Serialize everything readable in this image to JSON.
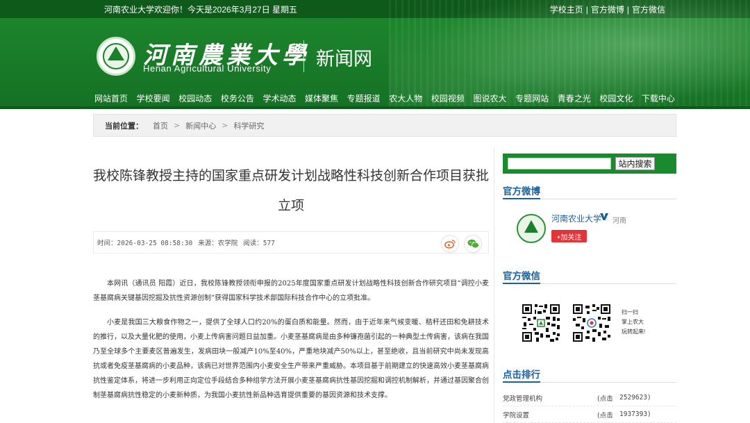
{
  "header": {
    "welcome": "河南农业大学欢迎你！今天是2026年3月27日 星期五",
    "top_links": [
      "学校主页",
      "官方微博",
      "官方微信"
    ],
    "logo_cn": "河南農業大學",
    "logo_en": "Henan Agricultural University",
    "site_title": "新闻网"
  },
  "nav": {
    "items": [
      "网站首页",
      "学校要闻",
      "校园动态",
      "校务公告",
      "学术动态",
      "媒体聚焦",
      "专题报道",
      "农大人物",
      "校园视频",
      "图说农大",
      "专题网站",
      "青春之光",
      "校园文化",
      "下载中心"
    ]
  },
  "breadcrumb": {
    "label": "当前位置：",
    "items": [
      "首页",
      "新闻中心",
      "科学研究"
    ]
  },
  "article": {
    "title": "我校陈锋教授主持的国家重点研发计划战略性科技创新合作项目获批立项",
    "meta": {
      "time_label": "时间：",
      "time": "2026-03-25 08:58:30",
      "source_label": "来源：",
      "source": "农学院",
      "views_label": "阅读：",
      "views": "577"
    },
    "paragraphs": [
      "本网讯（通讯员 阳霞）近日，我校陈锋教授领衔申报的2025年度国家重点研发计划战略性科技创新合作研究项目“调控小麦茎基腐病关键基因挖掘及抗性资源创制”获得国家科学技术部国际科技合作中心的立项批准。",
      "小麦是我国三大粮食作物之一，提供了全球人口约20%的蛋白质和能量。然而，由于近年来气候变暖、秸秆还田和免耕技术的推行，以及大量化肥的使用，小麦上传病害问题日益加重。小麦茎基腐病是由多种镰孢菌引起的一种典型土传病害，该病在我国乃至全球多个主要麦区普遍发生，发病田块一般减产10%至40%，严重地块减产50%以上，甚至绝收，且当前研究中尚未发现高抗或者免疫茎基腐病的小麦品种，该病已对世界范围内小麦安全生产带来严重威胁。本项目基于前期建立的快速高效小麦茎基腐病抗性鉴定体系，将进一步利用正向定位手段结合多种组学方法开展小麦茎基腐病抗性基因挖掘和调控机制解析，并通过基因聚合创制茎基腐病抗性稳定的小麦新种质，为我国小麦抗性新品种选育提供重要的基因资源和技术支撑。"
    ]
  },
  "sidebar": {
    "search": {
      "value": "",
      "button": "站内搜索"
    },
    "weibo": {
      "title": "官方微博",
      "account_name": "河南农业大学",
      "location": "河南",
      "follow_label": "+加关注"
    },
    "weixin": {
      "title": "官方微信",
      "note": [
        "扫一扫",
        "掌上农大",
        "玩转起来!"
      ]
    },
    "ranking": {
      "title": "点击排行",
      "click_label": "(点击",
      "items": [
        {
          "name": "党政管理机构",
          "clicks": "2529623)"
        },
        {
          "name": "学院设置",
          "clicks": "1937393)"
        }
      ]
    }
  },
  "colors": {
    "header_green": "#1a7f2a",
    "sidebar_heading_blue": "#1a5f9e",
    "follow_red": "#e3343a"
  }
}
